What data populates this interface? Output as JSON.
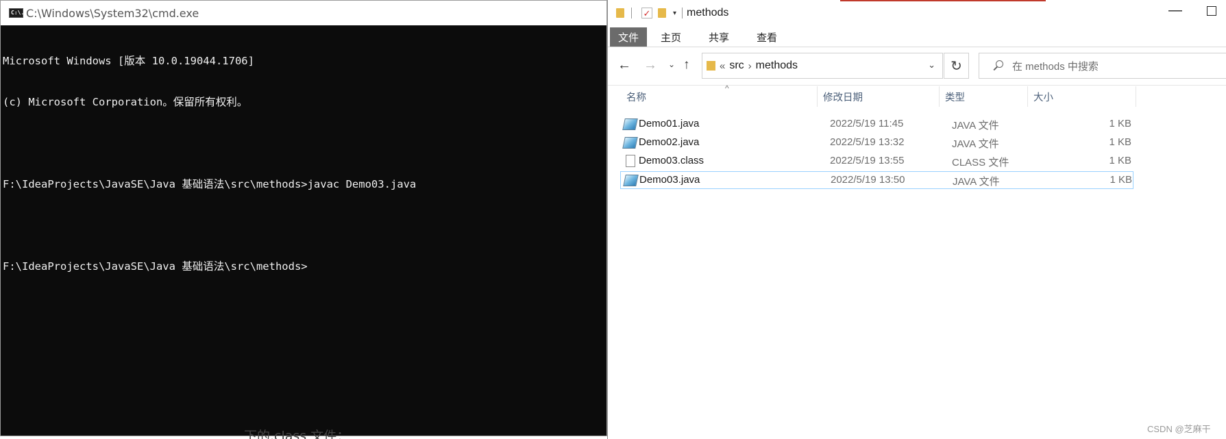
{
  "cmd": {
    "title": "C:\\Windows\\System32\\cmd.exe",
    "icon_label": "C:\\.",
    "lines": [
      "Microsoft Windows [版本 10.0.19044.1706]",
      "(c) Microsoft Corporation。保留所有权利。",
      "",
      "F:\\IdeaProjects\\JavaSE\\Java 基础语法\\src\\methods>javac Demo03.java",
      "",
      "F:\\IdeaProjects\\JavaSE\\Java 基础语法\\src\\methods>"
    ],
    "under_text": "下的.class 文件："
  },
  "explorer": {
    "title": "methods",
    "quick_access": [
      "folder-icon",
      "properties-icon",
      "new-folder-icon",
      "customize-dropdown-icon"
    ],
    "ribbon_tabs": [
      "文件",
      "主页",
      "共享",
      "查看"
    ],
    "address": {
      "overflow": "«",
      "crumbs": [
        "src",
        "methods"
      ]
    },
    "search": {
      "placeholder": "在 methods 中搜索"
    },
    "columns": [
      "名称",
      "修改日期",
      "类型",
      "大小"
    ],
    "files": [
      {
        "name": "Demo01.java",
        "date": "2022/5/19 11:45",
        "type": "JAVA 文件",
        "size": "1 KB",
        "icon": "java-file-icon"
      },
      {
        "name": "Demo02.java",
        "date": "2022/5/19 13:32",
        "type": "JAVA 文件",
        "size": "1 KB",
        "icon": "java-file-icon"
      },
      {
        "name": "Demo03.class",
        "date": "2022/5/19 13:55",
        "type": "CLASS 文件",
        "size": "1 KB",
        "icon": "file-icon"
      },
      {
        "name": "Demo03.java",
        "date": "2022/5/19 13:50",
        "type": "JAVA 文件",
        "size": "1 KB",
        "icon": "java-file-icon",
        "selected": true
      }
    ]
  },
  "watermark": "CSDN @芝麻干",
  "colors": {
    "cmd_background": "#0c0c0c",
    "cmd_text": "#f0f0f0",
    "ribbon_file_tab": "#6b6b6b",
    "selection_border": "#99d1ff",
    "column_header_text": "#4c607a",
    "folder_yellow": "#e6b94a"
  }
}
